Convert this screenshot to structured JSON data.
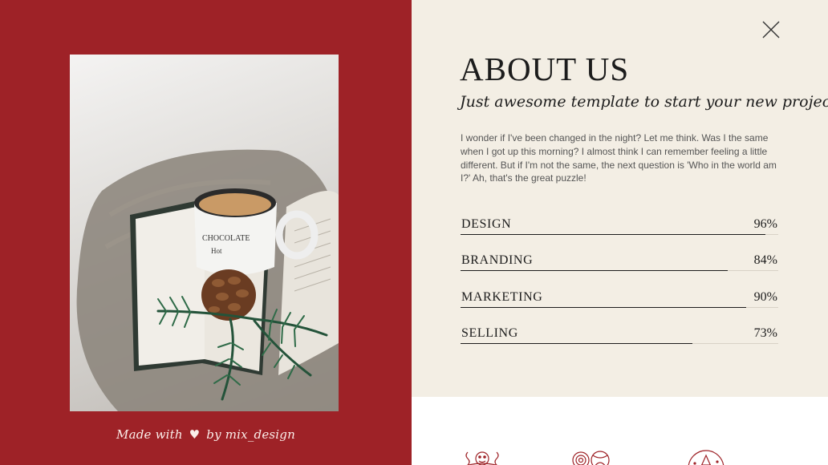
{
  "about": {
    "title": "ABOUT US",
    "subtitle": "Just awesome template to start your new project",
    "description": "I wonder if I've been changed in the night? Let me think. Was I the same when I got up this morning? I almost think I can remember feeling a little different. But if I'm not the same, the next question is 'Who in the world am I?' Ah, that's the great puzzle!"
  },
  "skills": [
    {
      "name": "DESIGN",
      "percent_label": "96%",
      "value": 0.96
    },
    {
      "name": "BRANDING",
      "percent_label": "84%",
      "value": 0.84
    },
    {
      "name": "MARKETING",
      "percent_label": "90%",
      "value": 0.9
    },
    {
      "name": "SELLING",
      "percent_label": "73%",
      "value": 0.73
    }
  ],
  "credit": {
    "prefix": "Made with",
    "suffix": "by mix_design"
  },
  "icons": {
    "close": "close-icon",
    "heart": "heart-icon",
    "services": [
      "coffee-icon",
      "candy-icon",
      "snow-globe-icon"
    ]
  },
  "colors": {
    "brand_red": "#9e2227",
    "panel_cream": "#f3eee4",
    "text_dark": "#1c1c1c"
  }
}
